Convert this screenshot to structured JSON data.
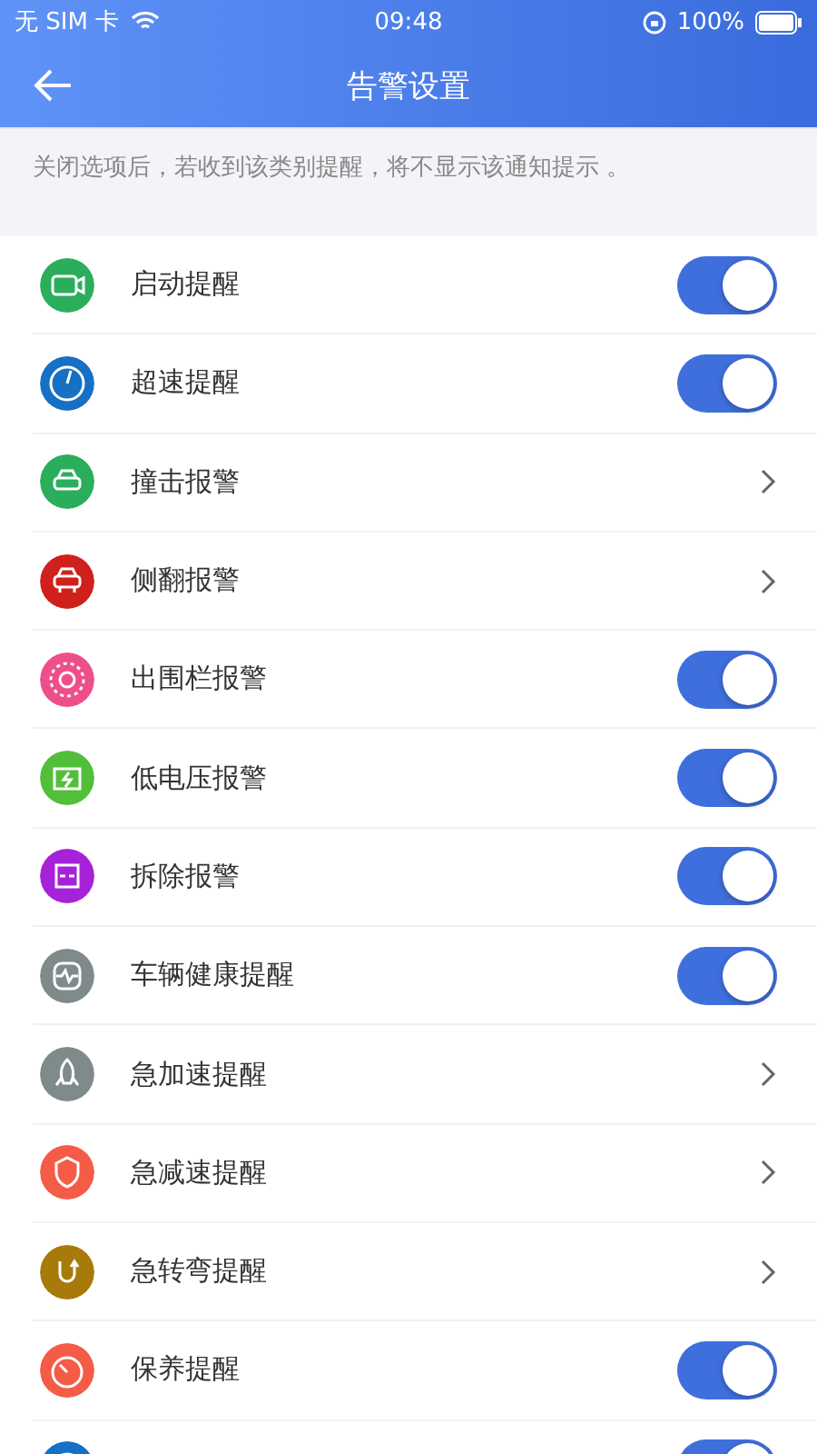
{
  "status_bar": {
    "carrier": "无 SIM 卡",
    "time": "09:48",
    "battery": "100%"
  },
  "header": {
    "title": "告警设置"
  },
  "note": "关闭选项后，若收到该类别提醒，将不显示该通知提示 。",
  "items": [
    {
      "label": "启动提醒",
      "color": "#2bae5c",
      "kind": "toggle",
      "on": true
    },
    {
      "label": "超速提醒",
      "color": "#1670c4",
      "kind": "toggle",
      "on": true
    },
    {
      "label": "撞击报警",
      "color": "#2bae5c",
      "kind": "link"
    },
    {
      "label": "侧翻报警",
      "color": "#d0201c",
      "kind": "link"
    },
    {
      "label": "出围栏报警",
      "color": "#ee4f8a",
      "kind": "toggle",
      "on": true
    },
    {
      "label": "低电压报警",
      "color": "#52bf3a",
      "kind": "toggle",
      "on": true
    },
    {
      "label": "拆除报警",
      "color": "#a622d8",
      "kind": "toggle",
      "on": true
    },
    {
      "label": "车辆健康提醒",
      "color": "#7f8b8a",
      "kind": "toggle",
      "on": true
    },
    {
      "label": "急加速提醒",
      "color": "#7f8b8a",
      "kind": "link"
    },
    {
      "label": "急减速提醒",
      "color": "#f45c48",
      "kind": "link"
    },
    {
      "label": "急转弯提醒",
      "color": "#a87a0a",
      "kind": "link"
    },
    {
      "label": "保养提醒",
      "color": "#f45c48",
      "kind": "toggle",
      "on": true
    },
    {
      "color": "#1670c4",
      "kind": "toggle",
      "on": true
    }
  ]
}
